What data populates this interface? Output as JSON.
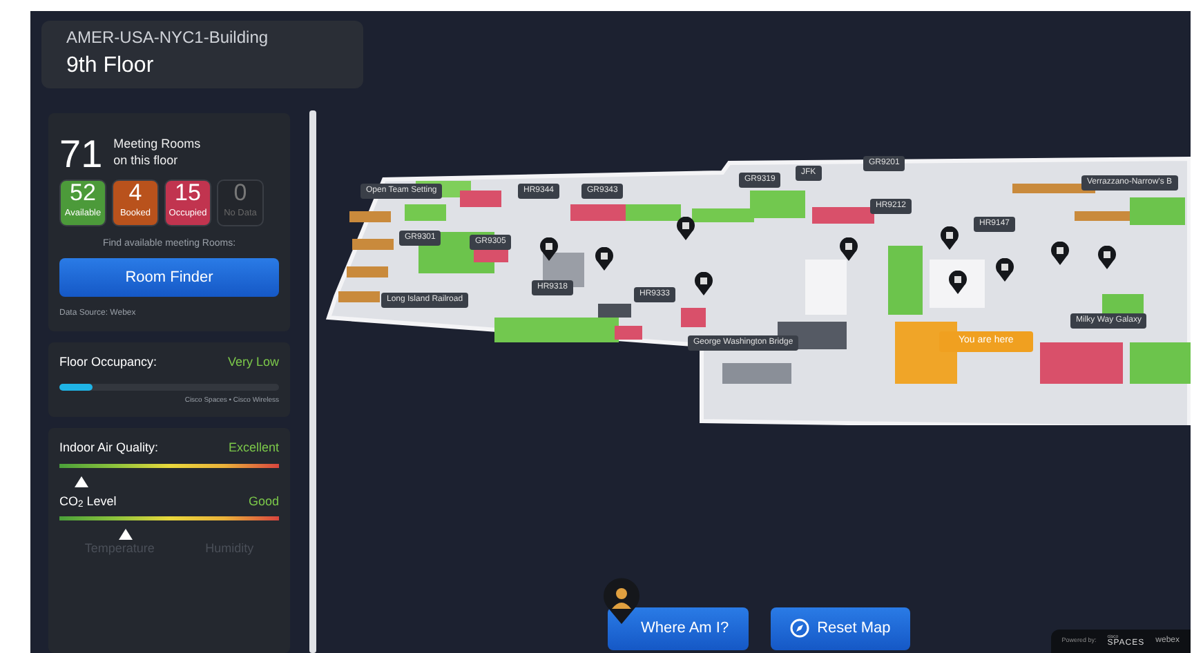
{
  "header": {
    "building": "AMER-USA-NYC1-Building",
    "floor": "9th Floor"
  },
  "rooms": {
    "total": "71",
    "caption_line1": "Meeting Rooms",
    "caption_line2": "on this floor",
    "counts": [
      {
        "kind": "available",
        "value": "52",
        "label": "Available",
        "color": "#4c9a3a"
      },
      {
        "kind": "booked",
        "value": "4",
        "label": "Booked",
        "color": "#b9521c"
      },
      {
        "kind": "occupied",
        "value": "15",
        "label": "Occupied",
        "color": "#c1344f"
      },
      {
        "kind": "nodata",
        "value": "0",
        "label": "No Data",
        "color": "#23262c"
      }
    ],
    "find_text": "Find available meeting Rooms:",
    "button": "Room Finder",
    "source": "Data Source: Webex"
  },
  "occupancy": {
    "label": "Floor Occupancy:",
    "value": "Very Low",
    "level": 0.15,
    "source": "Cisco Spaces • Cisco Wireless"
  },
  "environment": [
    {
      "label": "Indoor Air Quality:",
      "value": "Excellent",
      "level": 0.1
    },
    {
      "label": "CO$_{2}$ Level",
      "value": "Good",
      "level": 0.3
    }
  ],
  "faded_tabs": [
    "Temperature",
    "Humidity"
  ],
  "map_labels": [
    {
      "text": "GR9201",
      "kind": "room"
    },
    {
      "text": "JFK",
      "kind": "room"
    },
    {
      "text": "GR9319",
      "kind": "room"
    },
    {
      "text": "Verrazzano-Narrow's B",
      "kind": "room"
    },
    {
      "text": "Open Team Setting",
      "kind": "room"
    },
    {
      "text": "HR9344",
      "kind": "room"
    },
    {
      "text": "GR9343",
      "kind": "room"
    },
    {
      "text": "HR9212",
      "kind": "room"
    },
    {
      "text": "HR9147",
      "kind": "room"
    },
    {
      "text": "GR9301",
      "kind": "room"
    },
    {
      "text": "GR9305",
      "kind": "room"
    },
    {
      "text": "HR9318",
      "kind": "room"
    },
    {
      "text": "HR9333",
      "kind": "room"
    },
    {
      "text": "Long Island Railroad",
      "kind": "room"
    },
    {
      "text": "Milky Way Galaxy",
      "kind": "room"
    },
    {
      "text": "You are here",
      "kind": "location"
    },
    {
      "text": "George Washington Bridge",
      "kind": "room"
    }
  ],
  "buttons": [
    {
      "kind": "locate",
      "label": "Where Am I?"
    },
    {
      "kind": "reset",
      "label": "Reset Map"
    }
  ],
  "powered": {
    "label": "Powered by:",
    "brand1_small": "cisco",
    "brand1": "SPACES",
    "brand2": "webex"
  }
}
